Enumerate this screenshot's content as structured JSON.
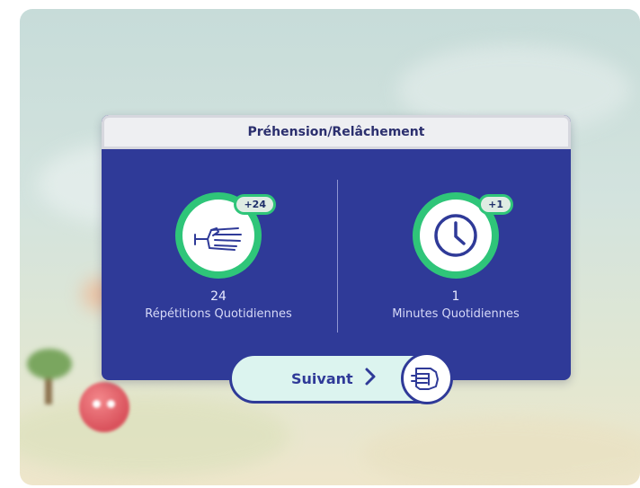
{
  "dialog": {
    "title": "Préhension/Relâchement",
    "stats": [
      {
        "icon": "hand-icon",
        "badge": "+24",
        "value": "24",
        "label": "Répétitions Quotidiennes"
      },
      {
        "icon": "clock-icon",
        "badge": "+1",
        "value": "1",
        "label": "Minutes Quotidiennes"
      }
    ],
    "next_button": {
      "label": "Suivant",
      "icon": "chevron-right-icon"
    },
    "gesture_icon": "fist-icon"
  },
  "colors": {
    "card_background": "#2f3a98",
    "ring_green": "#2fc579",
    "button_fill": "#dcf4ef",
    "header_background": "#eeeff2"
  }
}
